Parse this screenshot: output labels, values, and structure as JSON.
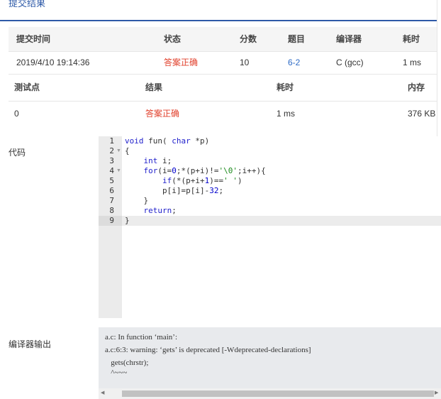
{
  "header": {
    "title": "提交结果"
  },
  "submission": {
    "columns": [
      "提交时间",
      "状态",
      "分数",
      "题目",
      "编译器",
      "耗时"
    ],
    "row": {
      "time": "2019/4/10 19:14:36",
      "status": "答案正确",
      "score": "10",
      "problem": "6-2",
      "compiler": "C (gcc)",
      "elapsed": "1 ms"
    }
  },
  "testcases": {
    "columns": [
      "测试点",
      "结果",
      "耗时",
      "内存"
    ],
    "row": {
      "point": "0",
      "result": "答案正确",
      "elapsed": "1 ms",
      "memory": "376 KB"
    }
  },
  "code_section": {
    "label": "代码",
    "line_numbers": [
      "1",
      "2",
      "3",
      "4",
      "5",
      "6",
      "7",
      "8",
      "9"
    ],
    "fold_markers": {
      "2": "▼",
      "4": "▼"
    },
    "lines": [
      "void fun( char *p)",
      "{",
      "    int i;",
      "    for(i=0;*(p+i)!='\\0';i++){",
      "        if(*(p+i+1)==' ')",
      "        p[i]=p[i]-32;",
      "    }",
      "    return;",
      "}"
    ]
  },
  "compiler_section": {
    "label": "编译器输出",
    "lines": [
      "a.c: In function ‘main’:",
      "a.c:6:3: warning: ‘gets’ is deprecated [-Wdeprecated-declarations]",
      "   gets(chrstr);",
      "   ^~~~"
    ]
  },
  "colors": {
    "accent": "#2e5aa8",
    "success_status": "#e1402c",
    "link": "#2e6bc6"
  }
}
